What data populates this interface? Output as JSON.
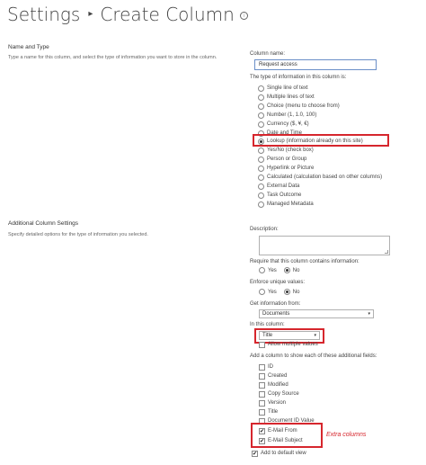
{
  "header": {
    "breadcrumb_root": "Settings",
    "separator": "▸",
    "page_title": "Create Column",
    "info_glyph": "i"
  },
  "name_type_section": {
    "title": "Name and Type",
    "description": "Type a name for this column, and select the type of information you want to store in the column.",
    "column_name_label": "Column name:",
    "column_name_value": "Request access",
    "type_label": "The type of information in this column is:",
    "types": [
      {
        "label": "Single line of text",
        "selected": false
      },
      {
        "label": "Multiple lines of text",
        "selected": false
      },
      {
        "label": "Choice (menu to choose from)",
        "selected": false
      },
      {
        "label": "Number (1, 1.0, 100)",
        "selected": false
      },
      {
        "label": "Currency ($, ¥, €)",
        "selected": false
      },
      {
        "label": "Date and Time",
        "selected": false
      },
      {
        "label": "Lookup (information already on this site)",
        "selected": true
      },
      {
        "label": "Yes/No (check box)",
        "selected": false
      },
      {
        "label": "Person or Group",
        "selected": false
      },
      {
        "label": "Hyperlink or Picture",
        "selected": false
      },
      {
        "label": "Calculated (calculation based on other columns)",
        "selected": false
      },
      {
        "label": "External Data",
        "selected": false
      },
      {
        "label": "Task Outcome",
        "selected": false
      },
      {
        "label": "Managed Metadata",
        "selected": false
      }
    ]
  },
  "additional_section": {
    "title": "Additional Column Settings",
    "description": "Specify detailed options for the type of information you selected.",
    "description_label": "Description:",
    "require_label": "Require that this column contains information:",
    "require_yes": "Yes",
    "require_no": "No",
    "require_selected": "No",
    "unique_label": "Enforce unique values:",
    "unique_yes": "Yes",
    "unique_no": "No",
    "unique_selected": "No",
    "get_info_label": "Get information from:",
    "get_info_value": "Documents",
    "in_column_label": "In this column:",
    "in_column_value": "Title",
    "allow_multiple_label": "Allow multiple values",
    "allow_multiple_checked": false,
    "add_column_label": "Add a column to show each of these additional fields:",
    "fields": [
      {
        "label": "ID",
        "checked": false
      },
      {
        "label": "Created",
        "checked": false
      },
      {
        "label": "Modified",
        "checked": false
      },
      {
        "label": "Copy Source",
        "checked": false
      },
      {
        "label": "Version",
        "checked": false
      },
      {
        "label": "Title",
        "checked": false
      },
      {
        "label": "Document ID Value",
        "checked": false
      },
      {
        "label": "E-Mail From",
        "checked": true
      },
      {
        "label": "E-Mail Subject",
        "checked": true
      }
    ],
    "add_default_view_label": "Add to default view",
    "add_default_view_checked": true
  },
  "annotations": {
    "extra_columns": "Extra columns",
    "highlight_color": "#d6262d"
  },
  "icons": {
    "select_arrow": "▾",
    "check": "✔"
  }
}
